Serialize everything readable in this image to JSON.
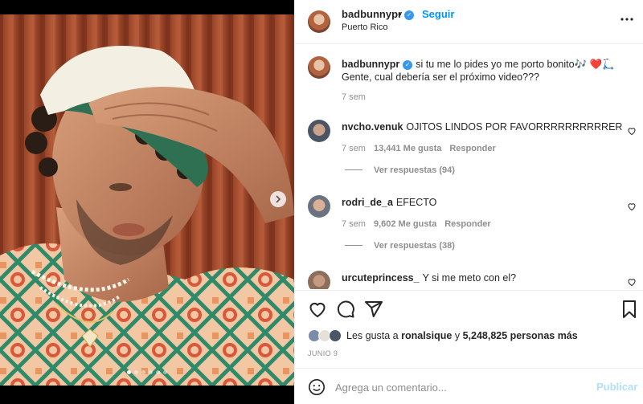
{
  "header": {
    "username": "badbunnypr",
    "separator": "•",
    "follow_label": "Seguir",
    "location": "Puerto Rico"
  },
  "caption": {
    "username": "badbunnypr",
    "line1": "si tu me lo pides yo me porto bonito🎶 ❤️🛴",
    "line2": "Gente, cual debería ser el próximo video???",
    "time": "7 sem"
  },
  "comments": [
    {
      "username": "nvcho.venuk",
      "text": "OJITOS LINDOS POR FAVORRRRRRRRRRER",
      "time": "7 sem",
      "likes": "13,441 Me gusta",
      "reply_label": "Responder",
      "view_replies": "Ver respuestas (94)"
    },
    {
      "username": "rodri_de_a",
      "text": "EFECTO",
      "time": "7 sem",
      "likes": "9,602 Me gusta",
      "reply_label": "Responder",
      "view_replies": "Ver respuestas (38)"
    },
    {
      "username": "urcuteprincess_",
      "text": "Y si me meto con el?"
    }
  ],
  "likes": {
    "prefix": "Les gusta a",
    "user": "ronalsique",
    "connector": "y",
    "others": "5,248,825 personas más"
  },
  "date": "JUNIO 9",
  "add_comment": {
    "placeholder": "Agrega un comentario...",
    "post_label": "Publicar"
  },
  "carousel": {
    "slide_count": 6,
    "active_index": 0
  },
  "colors": {
    "link_blue": "#0095f6",
    "verified_blue": "#3897f0",
    "muted": "#8e8e8e",
    "liked_red": "#ed4956",
    "post_disabled": "#b2dffc"
  }
}
